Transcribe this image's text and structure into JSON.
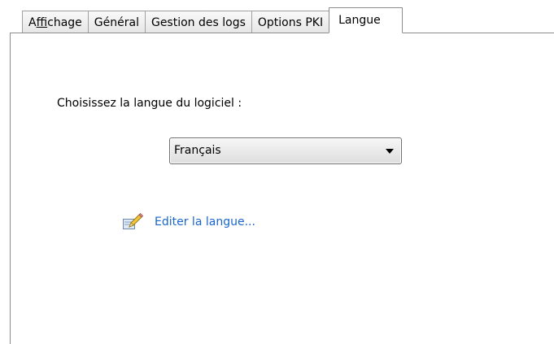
{
  "tabs": [
    {
      "label_prefix": "A",
      "label_accel": "f",
      "label_rest": "fichage",
      "active": false
    },
    {
      "label": "Général",
      "active": false
    },
    {
      "label": "Gestion des logs",
      "active": false
    },
    {
      "label": "Options PKI",
      "active": false
    },
    {
      "label": "Langue",
      "active": true
    }
  ],
  "language_panel": {
    "prompt": "Choisissez la langue du logiciel :",
    "selected_language": "Français",
    "edit_link": "Editer la langue...",
    "edit_icon": "edit-pencil-icon"
  },
  "colors": {
    "link": "#1a66cc",
    "border": "#8c8c8c"
  }
}
